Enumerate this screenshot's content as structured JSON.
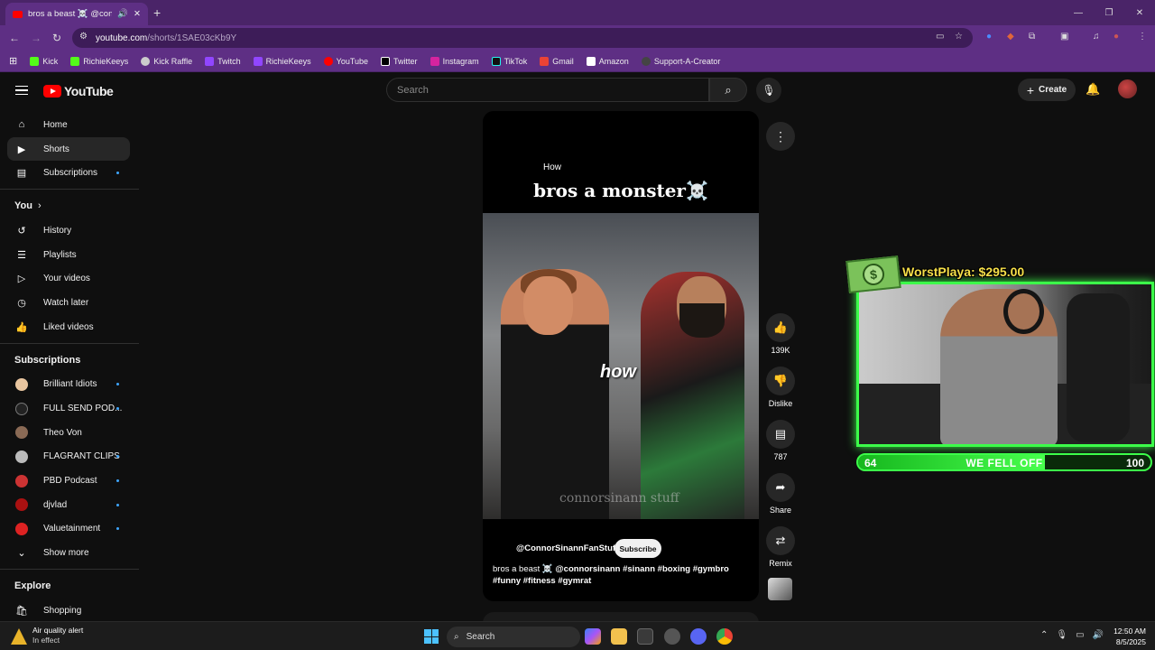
{
  "browser": {
    "tab_title": "bros a beast ☠️ @connorsi",
    "url_host": "youtube.com",
    "url_path": "/shorts/1SAE03cKb9Y",
    "bookmarks": [
      "Kick",
      "RichieKeeys",
      "Kick Raffle",
      "Twitch",
      "RichieKeeys",
      "YouTube",
      "Twitter",
      "Instagram",
      "TikTok",
      "Gmail",
      "Amazon",
      "Support-A-Creator"
    ]
  },
  "youtube": {
    "logo": "YouTube",
    "search_placeholder": "Search",
    "create_label": "Create",
    "sidebar": {
      "main": [
        "Home",
        "Shorts",
        "Subscriptions"
      ],
      "you_label": "You",
      "you_items": [
        "History",
        "Playlists",
        "Your videos",
        "Watch later",
        "Liked videos"
      ],
      "subs_label": "Subscriptions",
      "subs": [
        "Brilliant Idiots",
        "FULL SEND POD...",
        "Theo Von",
        "FLAGRANT CLIPS",
        "PBD Podcast",
        "djvlad",
        "Valuetainment"
      ],
      "show_more": "Show more",
      "explore_label": "Explore",
      "explore_items": [
        "Shopping"
      ]
    },
    "short": {
      "overlay_small": "How",
      "overlay_caption": "bros a monster☠️",
      "video_text": "how",
      "watermark": "connorsinann stuff",
      "channel": "@ConnorSinannFanStuff",
      "subscribe_label": "Subscribe",
      "desc_plain": "bros a beast ☠️",
      "desc_tags": "@connorsinann #sinann #boxing #gymbro #funny #fitness #gymrat"
    },
    "actions": {
      "likes": "139K",
      "dislike": "Dislike",
      "comments": "787",
      "share": "Share",
      "remix": "Remix"
    }
  },
  "stream_overlay": {
    "donor_text": "WorstPlaya: $295.00",
    "bar_left": "64",
    "bar_label": "WE FELL OFF",
    "bar_right": "100",
    "bar_progress": 0.64
  },
  "taskbar": {
    "weather_title": "Air quality alert",
    "weather_sub": "In effect",
    "search_label": "Search",
    "time": "12:50 AM",
    "date": "8/5/2025"
  }
}
